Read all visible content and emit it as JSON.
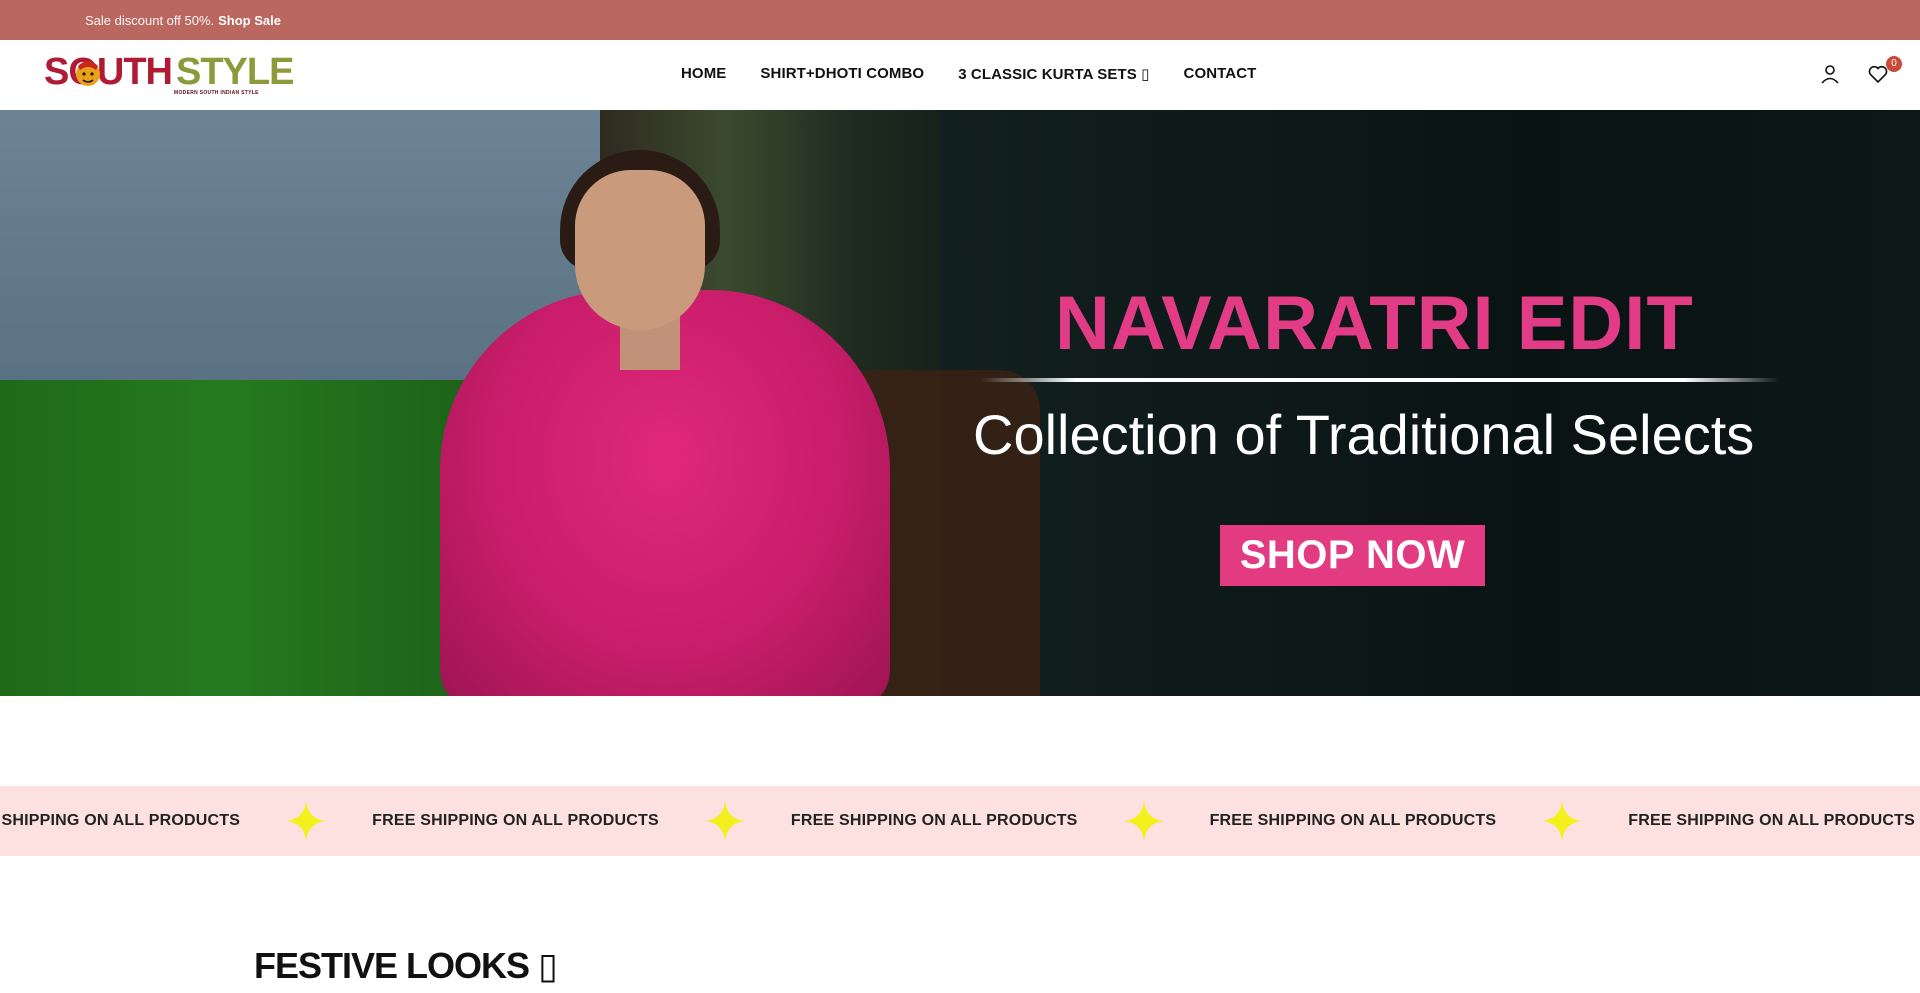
{
  "announcement": {
    "text": "Sale discount off 50%.",
    "link": "Shop Sale"
  },
  "header": {
    "logo_south": "SOUTH",
    "logo_style": "STYLE",
    "logo_tagline": "MODERN SOUTH INDIAN STYLE",
    "nav": [
      {
        "label": "HOME"
      },
      {
        "label": "SHIRT+DHOTI COMBO"
      },
      {
        "label": "3 CLASSIC KURTA SETS ▯"
      },
      {
        "label": "CONTACT"
      }
    ],
    "account_icon": "user-icon",
    "wishlist_icon": "heart-icon",
    "wishlist_count": "0"
  },
  "hero": {
    "title": "NAVARATRI EDIT",
    "subtitle": "Collection of Traditional Selects",
    "button": "SHOP NOW"
  },
  "marquee": {
    "items": [
      "E SHIPPING ON ALL PRODUCTS",
      "FREE SHIPPING ON ALL PRODUCTS",
      "FREE SHIPPING ON ALL PRODUCTS",
      "FREE SHIPPING ON ALL PRODUCTS",
      "FREE SHIPPING ON ALL PRODUCTS"
    ],
    "star_color": "#f4f01e"
  },
  "section": {
    "title": "FESTIVE LOOKS ▯"
  },
  "colors": {
    "announcement_bg": "#b9675f",
    "accent_pink": "#e33c86",
    "marquee_bg": "#fde0e0",
    "badge": "#c94a3a"
  }
}
